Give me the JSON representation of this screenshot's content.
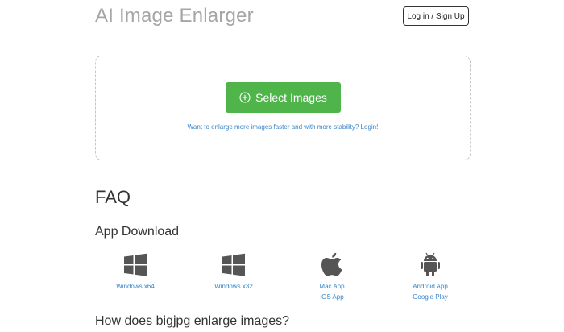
{
  "header": {
    "title": "AI Image Enlarger",
    "login_label": "Log in / Sign Up"
  },
  "upload": {
    "select_label": "Select Images",
    "stability_link": "Want to enlarge more images faster and with more stability? Login!"
  },
  "faq": {
    "title": "FAQ",
    "app_download_heading": "App Download",
    "downloads": [
      {
        "icon": "windows-icon",
        "links": [
          "Windows x64"
        ]
      },
      {
        "icon": "windows-icon",
        "links": [
          "Windows x32"
        ]
      },
      {
        "icon": "apple-icon",
        "links": [
          "Mac App",
          "iOS App"
        ]
      },
      {
        "icon": "android-icon",
        "links": [
          "Android App",
          "Google Play"
        ]
      }
    ],
    "how_heading": "How does bigjpg enlarge images?"
  },
  "colors": {
    "accent_green": "#4fb54a",
    "link_blue": "#3a86c8",
    "icon_gray": "#555555"
  }
}
